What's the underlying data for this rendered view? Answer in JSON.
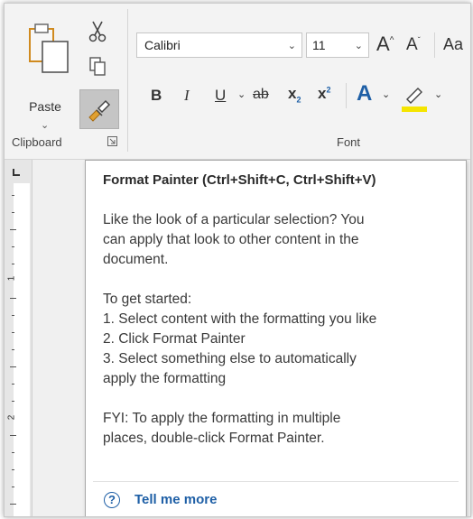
{
  "ribbon": {
    "clipboard_group_label": "Clipboard",
    "font_group_label": "Font",
    "paste_label": "Paste",
    "paste_dropdown": "⌄",
    "font_name": "Calibri",
    "font_size": "11",
    "dropdown_glyph": "⌄",
    "grow_font": "A",
    "shrink_font": "A",
    "change_case": "Aa",
    "bold": "B",
    "italic": "I",
    "underline": "U",
    "strikethrough": "ab",
    "subscript": "x",
    "superscript": "x",
    "text_effects": "A",
    "highlight_color": "#f5e500",
    "accent_color": "#1e5fa6"
  },
  "ruler": {
    "marks": [
      "1",
      "2"
    ]
  },
  "tooltip": {
    "title": "Format Painter (Ctrl+Shift+C, Ctrl+Shift+V)",
    "lines": [
      "Like the look of a particular selection? You",
      "can apply that look to other content in the",
      "document.",
      "",
      "To get started:",
      "1. Select content with the formatting you like",
      "2. Click Format Painter",
      "3. Select something else to automatically",
      "apply the formatting",
      "",
      "FYI: To apply the formatting in multiple",
      "places, double-click Format Painter."
    ],
    "help_glyph": "?",
    "link": "Tell me more"
  }
}
